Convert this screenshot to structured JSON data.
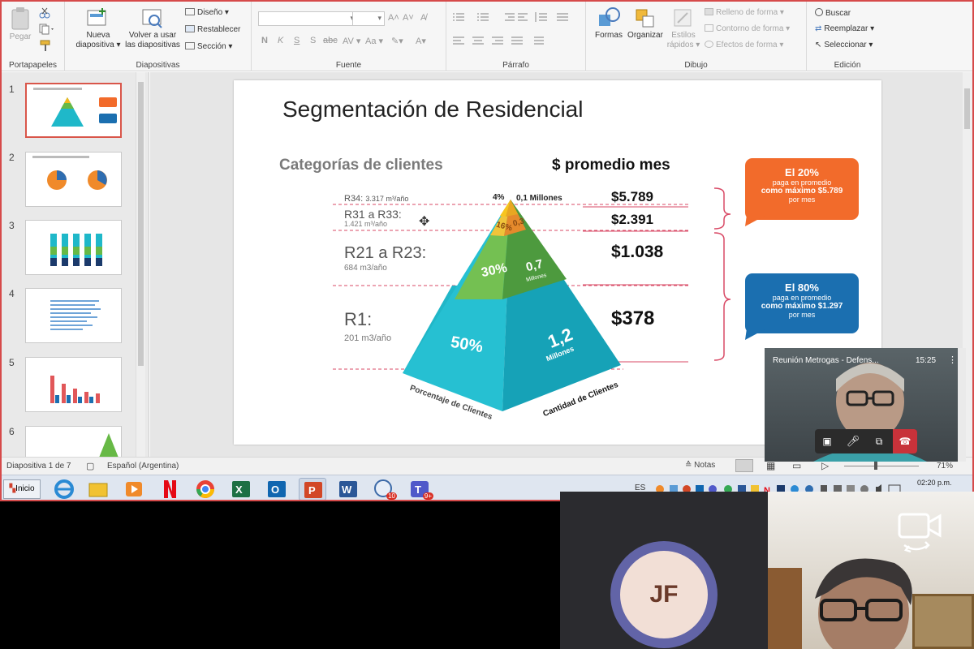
{
  "ribbon": {
    "portapapeles": {
      "pegar": "Pegar",
      "group": "Portapapeles"
    },
    "diapositivas": {
      "nueva_l1": "Nueva",
      "nueva_l2": "diapositiva ▾",
      "volver_l1": "Volver a usar",
      "volver_l2": "las diapositivas",
      "diseno": "Diseño ▾",
      "restablecer": "Restablecer",
      "seccion": "Sección ▾",
      "group": "Diapositivas"
    },
    "fuente": {
      "group": "Fuente",
      "bold": "N",
      "italic": "K",
      "underline": "S",
      "shadow": "S",
      "strike": "abc",
      "spacing": "AV ▾",
      "case": "Aa ▾"
    },
    "parrafo": {
      "group": "Párrafo"
    },
    "dibujo": {
      "formas": "Formas",
      "organizar": "Organizar",
      "estilos_l1": "Estilos",
      "estilos_l2": "rápidos ▾",
      "relleno": "Relleno de forma ▾",
      "contorno": "Contorno de forma ▾",
      "efectos": "Efectos de forma ▾",
      "group": "Dibujo"
    },
    "edicion": {
      "buscar": "Buscar",
      "reemplazar": "Reemplazar ▾",
      "seleccionar": "Seleccionar ▾",
      "group": "Edición"
    }
  },
  "thumbnails": [
    {
      "num": "1"
    },
    {
      "num": "2"
    },
    {
      "num": "3"
    },
    {
      "num": "4"
    },
    {
      "num": "5"
    },
    {
      "num": "6"
    }
  ],
  "slide": {
    "title": "Segmentación de Residencial",
    "categorias": "Categorías de clientes",
    "promedio": "$ promedio mes",
    "rows": [
      {
        "cat": "R34:",
        "detail": "3.317 m³/año",
        "pct": "4%",
        "clientes": "0,1 Millones",
        "amount": "$5.789"
      },
      {
        "cat": "R31 a R33:",
        "detail": "1.421 m³/año",
        "pct": "16%",
        "clientes": "0,3",
        "amount": "$2.391"
      },
      {
        "cat": "R21 a R23:",
        "detail": "684 m3/año",
        "pct": "30%",
        "clientes": "0,7",
        "clientes_unit": "Millones",
        "amount": "$1.038"
      },
      {
        "cat": "R1:",
        "detail": "201 m3/año",
        "pct": "50%",
        "clientes": "1,2",
        "clientes_unit": "Millones",
        "amount": "$378"
      }
    ],
    "left_face_label": "Porcentaje de Clientes",
    "right_face_label": "Cantidad de Clientes",
    "callout_orange": {
      "l1": "El 20%",
      "l2": "paga en promedio",
      "l3": "como máximo $5.789",
      "l4": "por mes"
    },
    "callout_blue": {
      "l1": "El 80%",
      "l2": "paga en promedio",
      "l3": "como máximo $1.297",
      "l4": "por mes"
    }
  },
  "statusbar": {
    "slide_info": "Diapositiva 1 de 7",
    "language": "Español (Argentina)",
    "notes": "Notas",
    "zoom": "71%"
  },
  "taskbar": {
    "start": "Inicio",
    "lang": "ES",
    "time": "02:20 p.m.",
    "outlook_badge": "10",
    "teams_badge": "9+"
  },
  "meeting_pip": {
    "title": "Reunión Metrogas - Defens...",
    "elapsed": "15:25"
  },
  "participant": {
    "initials": "JF"
  },
  "colors": {
    "orange": "#f26b2b",
    "blue": "#1b6fb0",
    "pyr_top": "#f4b81c",
    "pyr_mid1": "#e8842a",
    "pyr_mid2": "#67b946",
    "pyr_base": "#1fb8c9",
    "end_call": "#c8323a"
  }
}
